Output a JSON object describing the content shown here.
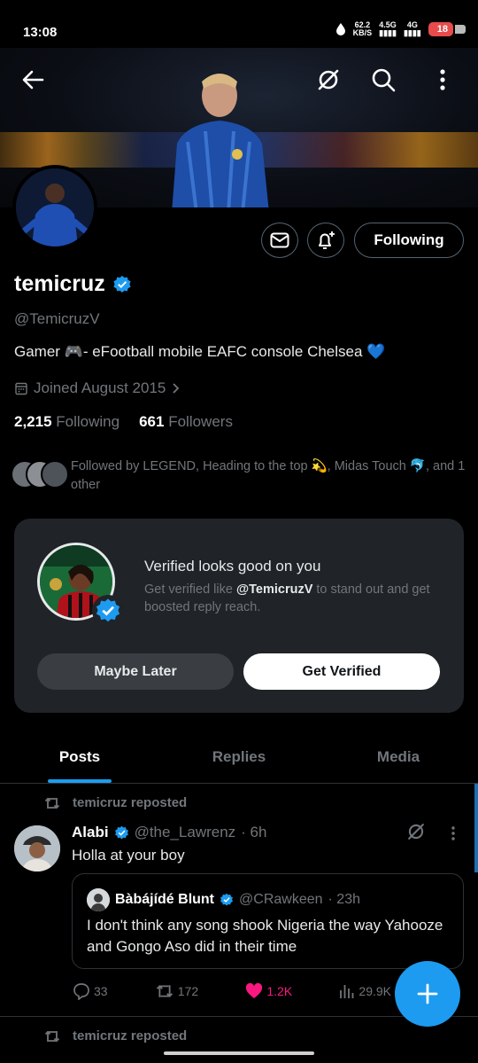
{
  "status_bar": {
    "time": "13:08",
    "net_speed_top": "62.2",
    "net_speed_unit": "KB/S",
    "net1": "4.5G",
    "net2": "4G",
    "battery": "18"
  },
  "profile": {
    "display_name": "temicruz",
    "handle": "@TemicruzV",
    "bio": "Gamer 🎮- eFootball mobile  EAFC console   Chelsea 💙",
    "joined": "Joined August 2015",
    "following_count": "2,215",
    "following_label": "Following",
    "followers_count": "661",
    "followers_label": "Followers",
    "followed_by": "Followed by LEGEND, Heading to the top 💫, Midas Touch 🐬, and 1 other",
    "follow_button_label": "Following"
  },
  "verified_card": {
    "title": "Verified looks good on you",
    "subtitle_prefix": "Get verified like ",
    "subtitle_handle": "@TemicruzV",
    "subtitle_suffix": " to stand out and get boosted reply reach.",
    "maybe_later": "Maybe Later",
    "get_verified": "Get Verified"
  },
  "tabs": [
    {
      "label": "Posts",
      "active": true
    },
    {
      "label": "Replies",
      "active": false
    },
    {
      "label": "Media",
      "active": false
    }
  ],
  "post": {
    "repost_label": "temicruz reposted",
    "author_name": "Alabi",
    "author_handle": "@the_Lawrenz",
    "time": "· 6h",
    "text": "Holla at your boy",
    "quote": {
      "author_name": "Bàbájídé Blunt",
      "author_handle": "@CRawkeen",
      "time": "· 23h",
      "text": "I don't think any song shook Nigeria the way Yahooze and Gongo Aso did in their time"
    },
    "replies": "33",
    "reposts": "172",
    "likes": "1.2K",
    "views": "29.9K"
  },
  "next_repost_label": "temicruz reposted",
  "colors": {
    "accent": "#1d9bf0",
    "like": "#f91880",
    "card_bg": "#202327"
  }
}
